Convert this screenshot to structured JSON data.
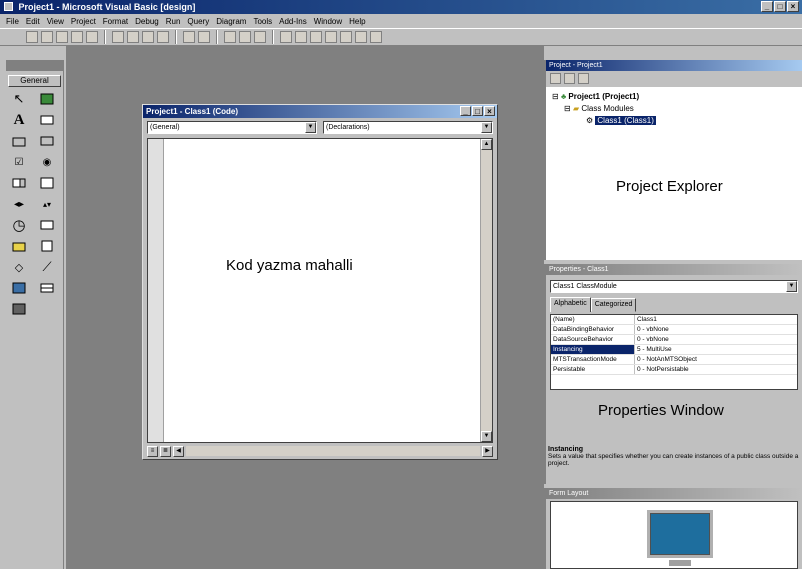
{
  "app": {
    "title": "Project1 - Microsoft Visual Basic [design]",
    "window_buttons": [
      "_",
      "□",
      "×"
    ]
  },
  "menu": [
    "File",
    "Edit",
    "View",
    "Project",
    "Format",
    "Debug",
    "Run",
    "Query",
    "Diagram",
    "Tools",
    "Add-Ins",
    "Window",
    "Help"
  ],
  "toolbox": {
    "title": "",
    "tab": "General",
    "tools": [
      "pointer-icon",
      "picturebox-icon",
      "label-icon",
      "textbox-icon",
      "frame-icon",
      "commandbutton-icon",
      "checkbox-icon",
      "optionbutton-icon",
      "combobox-icon",
      "listbox-icon",
      "hscrollbar-icon",
      "vscrollbar-icon",
      "timer-icon",
      "drivelistbox-icon",
      "dirlistbox-icon",
      "filelistbox-icon",
      "shape-icon",
      "line-icon",
      "image-icon",
      "data-icon",
      "ole-icon"
    ]
  },
  "code_window": {
    "title": "Project1 - Class1 (Code)",
    "object_combo": "(General)",
    "proc_combo": "(Declarations)",
    "label": "Kod yazma mahalli"
  },
  "project_explorer": {
    "title": "Project - Project1",
    "tree": {
      "root": "Project1 (Project1)",
      "folder": "Class Modules",
      "item": "Class1 (Class1)"
    },
    "label": "Project Explorer"
  },
  "properties": {
    "title": "Properties - Class1",
    "object_combo": "Class1 ClassModule",
    "tabs": [
      "Alphabetic",
      "Categorized"
    ],
    "rows": [
      {
        "name": "(Name)",
        "value": "Class1"
      },
      {
        "name": "DataBindingBehavior",
        "value": "0 - vbNone"
      },
      {
        "name": "DataSourceBehavior",
        "value": "0 - vbNone"
      },
      {
        "name": "Instancing",
        "value": "5 - MultiUse"
      },
      {
        "name": "MTSTransactionMode",
        "value": "0 - NotAnMTSObject"
      },
      {
        "name": "Persistable",
        "value": "0 - NotPersistable"
      }
    ],
    "label": "Properties Window",
    "desc_title": "Instancing",
    "desc_text": "Sets a value that specifies whether you can create instances of a public class outside a project."
  },
  "form_layout": {
    "title": "Form Layout"
  }
}
